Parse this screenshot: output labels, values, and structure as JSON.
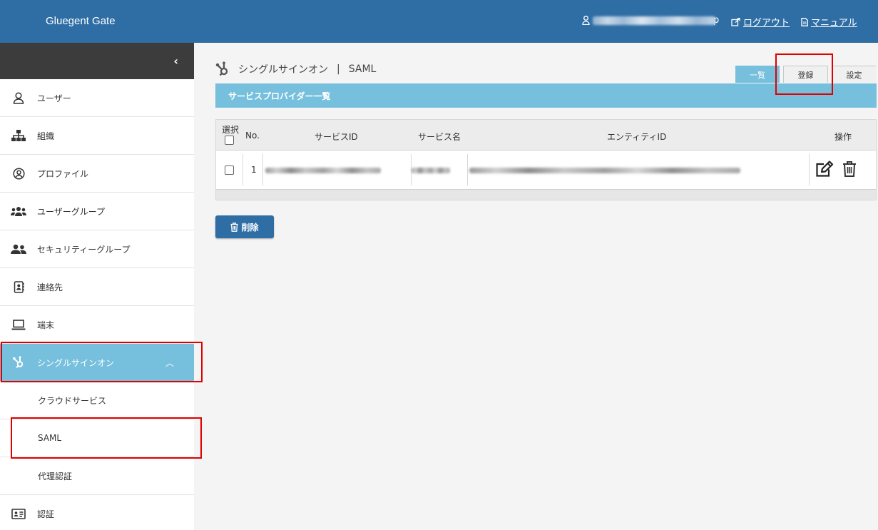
{
  "header": {
    "brand": "Gluegent Gate",
    "user_suffix": "p",
    "logout": "ログアウト",
    "manual": "マニュアル"
  },
  "sidebar": {
    "collapse_icon": "chevron-left-icon",
    "items": [
      {
        "label": "ユーザー",
        "icon": "user-icon"
      },
      {
        "label": "組織",
        "icon": "sitemap-icon"
      },
      {
        "label": "プロファイル",
        "icon": "user-circle-icon"
      },
      {
        "label": "ユーザーグループ",
        "icon": "users-group-icon"
      },
      {
        "label": "セキュリティーグループ",
        "icon": "user-friends-icon"
      },
      {
        "label": "連絡先",
        "icon": "address-book-icon"
      },
      {
        "label": "端末",
        "icon": "laptop-icon"
      },
      {
        "label": "シングルサインオン",
        "icon": "hub-icon"
      }
    ],
    "sub_items": [
      "クラウドサービス",
      "SAML",
      "代理認証"
    ],
    "last_item": {
      "label": "認証",
      "icon": "id-card-icon"
    }
  },
  "main": {
    "title": "シングルサインオン",
    "separator": "|",
    "subtitle": "SAML",
    "tabs": [
      "一覧",
      "登録",
      "設定"
    ],
    "section_title": "サービスプロバイダー一覧",
    "table": {
      "headers": {
        "select": "選択",
        "no": "No.",
        "service_id": "サービスID",
        "service_name": "サービス名",
        "entity_id": "エンティティID",
        "actions": "操作"
      },
      "rows": [
        {
          "no": "1"
        }
      ]
    },
    "delete_button": "削除"
  },
  "colors": {
    "header": "#2f6ea5",
    "accent": "#77c0dd",
    "highlight": "#e00000"
  }
}
